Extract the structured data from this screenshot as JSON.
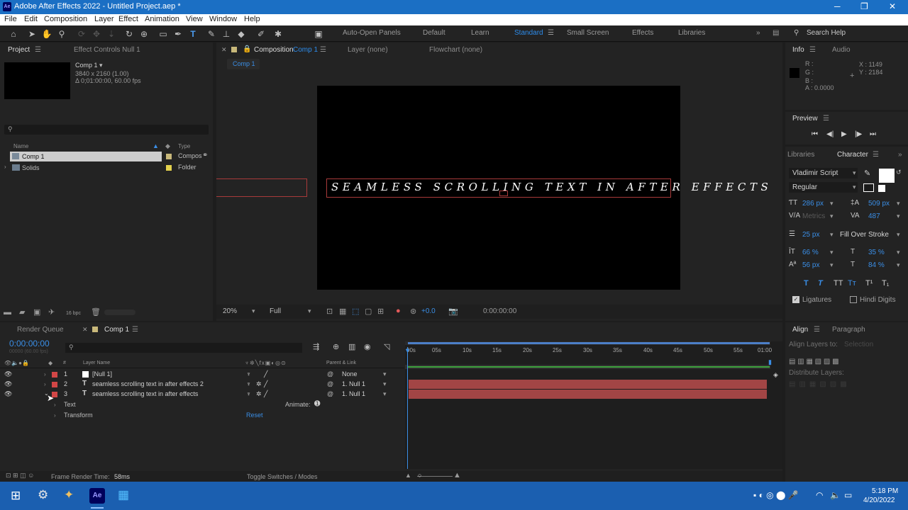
{
  "window": {
    "app_icon": "Ae",
    "title": "Adobe After Effects 2022 - Untitled Project.aep *"
  },
  "menu": [
    "File",
    "Edit",
    "Composition",
    "Layer",
    "Effect",
    "Animation",
    "View",
    "Window",
    "Help"
  ],
  "toolbar": {
    "auto_open_panels": "Auto-Open Panels",
    "workspaces": [
      "Default",
      "Learn",
      "Standard",
      "Small Screen",
      "Effects",
      "Libraries"
    ],
    "active_workspace": "Standard",
    "search_help": "Search Help"
  },
  "project_panel": {
    "tab_project": "Project",
    "tab_effect_controls": "Effect Controls Null 1",
    "comp_name": "Comp 1",
    "comp_size": "3840 x 2160 (1.00)",
    "comp_duration": "Δ 0;01:00:00, 60.00 fps",
    "col_name": "Name",
    "col_type": "Type",
    "items": [
      {
        "name": "Comp 1",
        "type": "Compos",
        "color": "#c8b87a"
      },
      {
        "name": "Solids",
        "type": "Folder",
        "color": "#e3d14d"
      }
    ],
    "bpc": "16 bpc"
  },
  "comp_panel": {
    "tab_composition": "Composition",
    "tab_comp_name": "Comp 1",
    "tab_layer": "Layer (none)",
    "tab_flowchart": "Flowchart (none)",
    "breadcrumb": "Comp 1",
    "canvas_text": "SEAMLESS SCROLLING TEXT IN AFTER EFFECTS",
    "zoom": "20%",
    "resolution": "Full",
    "exposure": "+0.0",
    "timecode": "0:00:00:00"
  },
  "info_panel": {
    "tab_info": "Info",
    "tab_audio": "Audio",
    "r": "R :",
    "g": "G :",
    "b": "B :",
    "a": "A : 0.0000",
    "x": "X : 1149",
    "y": "Y : 2184"
  },
  "preview_panel": {
    "title": "Preview"
  },
  "character_panel": {
    "tab_libraries": "Libraries",
    "tab_character": "Character",
    "font": "Vladimir Script",
    "style": "Regular",
    "size": "286 px",
    "leading": "509 px",
    "kerning": "Metrics",
    "tracking": "487",
    "stroke": "25 px",
    "stroke_mode": "Fill Over Stroke",
    "vscale": "66 %",
    "hscale": "35 %",
    "baseline": "56 px",
    "tsume": "84 %",
    "ligatures": "Ligatures",
    "hindi_digits": "Hindi Digits"
  },
  "align_panel": {
    "tab_align": "Align",
    "tab_paragraph": "Paragraph",
    "align_to_label": "Align Layers to:",
    "align_to_value": "Selection",
    "distribute": "Distribute Layers:"
  },
  "timeline": {
    "tab_render_queue": "Render Queue",
    "tab_comp": "Comp 1",
    "timecode": "0:00:00:00",
    "fps": "00000 (60.00 fps)",
    "col_layer_name": "Layer Name",
    "col_parent": "Parent & Link",
    "ruler": [
      "00s",
      "05s",
      "10s",
      "15s",
      "20s",
      "25s",
      "30s",
      "35s",
      "40s",
      "45s",
      "50s",
      "55s",
      "01:00"
    ],
    "layers": [
      {
        "num": "1",
        "name": "[Null 1]",
        "parent": "None",
        "type": "null"
      },
      {
        "num": "2",
        "name": "seamless scrolling text in after effects 2",
        "parent": "1. Null 1",
        "type": "text"
      },
      {
        "num": "3",
        "name": "seamless scrolling text in after effects",
        "parent": "1. Null 1",
        "type": "text"
      }
    ],
    "prop_text": "Text",
    "prop_transform": "Transform",
    "animate": "Animate:",
    "reset": "Reset",
    "frame_render_label": "Frame Render Time:",
    "frame_render_value": "58ms",
    "toggle": "Toggle Switches / Modes"
  },
  "taskbar": {
    "time": "5:18 PM",
    "date": "4/20/2022"
  }
}
